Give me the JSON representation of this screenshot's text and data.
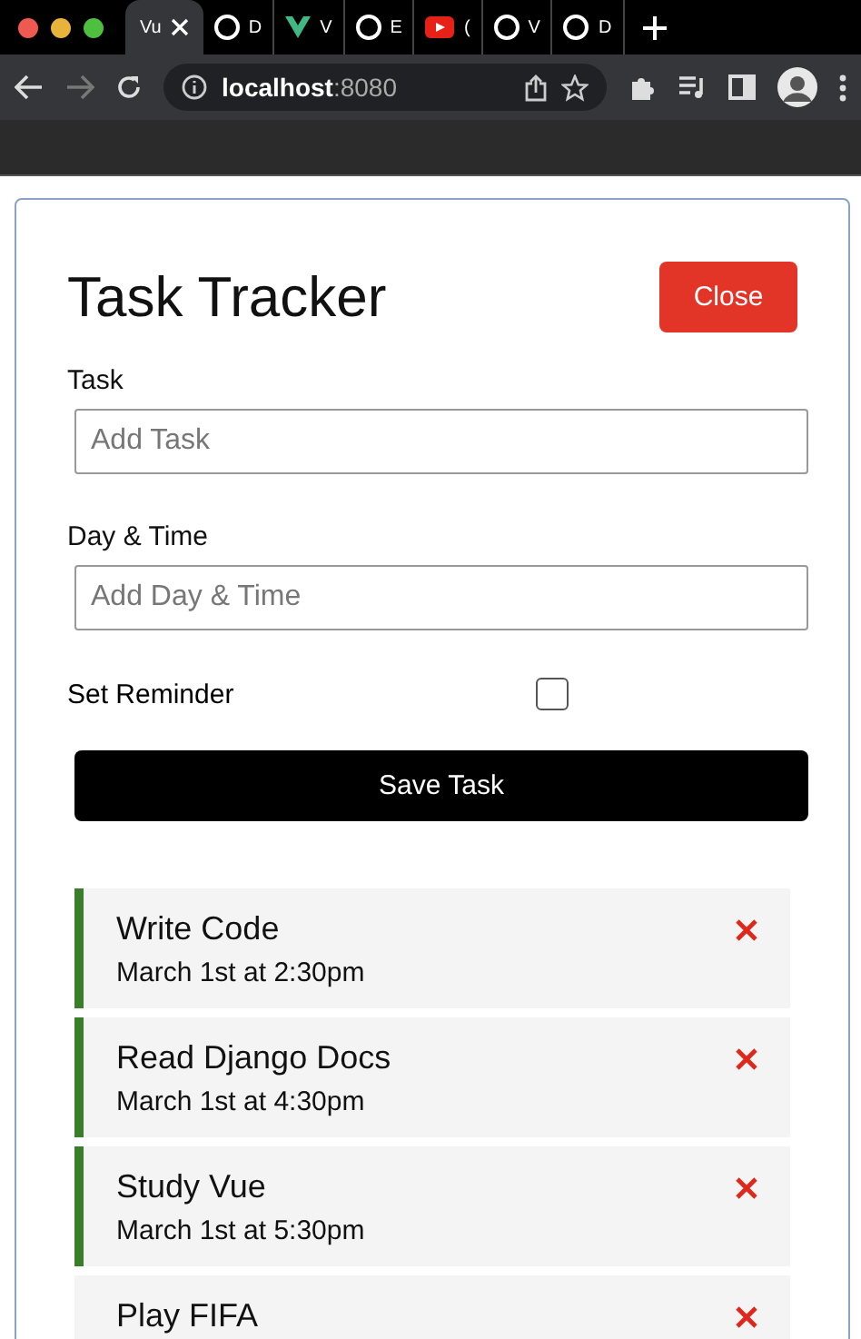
{
  "browser": {
    "tabs": [
      {
        "title": "Vu",
        "selected": true,
        "kind": "vue"
      },
      {
        "title": "D",
        "selected": false,
        "kind": "github"
      },
      {
        "title": "V",
        "selected": false,
        "kind": "vue"
      },
      {
        "title": "E",
        "selected": false,
        "kind": "github"
      },
      {
        "title": "(",
        "selected": false,
        "kind": "youtube"
      },
      {
        "title": "V",
        "selected": false,
        "kind": "github"
      },
      {
        "title": "D",
        "selected": false,
        "kind": "github"
      }
    ],
    "address": {
      "host": "localhost",
      "port": ":8080"
    }
  },
  "app": {
    "title": "Task Tracker",
    "close_button": "Close",
    "form": {
      "task_label": "Task",
      "task_placeholder": "Add Task",
      "day_label": "Day & Time",
      "day_placeholder": "Add Day & Time",
      "reminder_label": "Set Reminder",
      "reminder_checked": false,
      "save_button": "Save Task"
    },
    "tasks": [
      {
        "text": "Write Code",
        "day": "March 1st at 2:30pm",
        "reminder": true
      },
      {
        "text": "Read Django Docs",
        "day": "March 1st at 4:30pm",
        "reminder": true
      },
      {
        "text": "Study Vue",
        "day": "March 1st at 5:30pm",
        "reminder": true
      },
      {
        "text": "Play FIFA",
        "reminder": false
      }
    ]
  }
}
